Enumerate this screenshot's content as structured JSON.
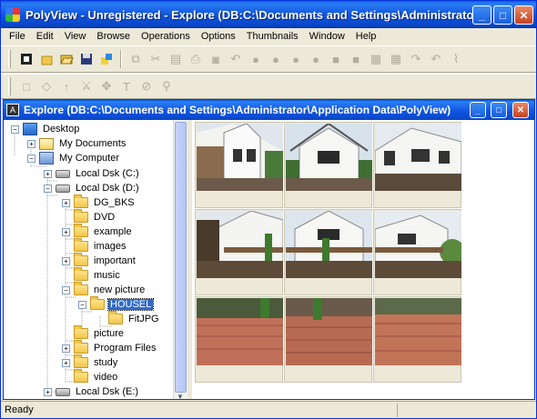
{
  "window": {
    "title": "PolyView - Unregistered - Explore (DB:C:\\Documents and Settings\\Administrator\\Application Data\\PolyView)",
    "minimize_label": "_",
    "maximize_label": "□",
    "close_label": "✕"
  },
  "menu": [
    "File",
    "Edit",
    "View",
    "Browse",
    "Operations",
    "Options",
    "Thumbnails",
    "Window",
    "Help"
  ],
  "child_window": {
    "title": "Explore (DB:C:\\Documents and Settings\\Administrator\\Application Data\\PolyView)",
    "icon_label": "A"
  },
  "tree": {
    "items": [
      {
        "label": "Desktop",
        "icon": "desktop-icon",
        "toggle": "−"
      },
      {
        "label": "My Documents",
        "icon": "my-documents-icon",
        "toggle": "+"
      },
      {
        "label": "My Computer",
        "icon": "my-computer-icon",
        "toggle": "−"
      },
      {
        "label": "Local Dsk (C:)",
        "icon": "drive-icon",
        "toggle": "+"
      },
      {
        "label": "Local Dsk (D:)",
        "icon": "drive-icon",
        "toggle": "−"
      },
      {
        "label": "DG_BKS",
        "icon": "folder-icon",
        "toggle": "+"
      },
      {
        "label": "DVD",
        "icon": "folder-icon",
        "toggle": ""
      },
      {
        "label": "example",
        "icon": "folder-icon",
        "toggle": "+"
      },
      {
        "label": "images",
        "icon": "folder-icon",
        "toggle": ""
      },
      {
        "label": "important",
        "icon": "folder-icon",
        "toggle": "+"
      },
      {
        "label": "music",
        "icon": "folder-icon",
        "toggle": ""
      },
      {
        "label": "new picture",
        "icon": "folder-icon",
        "toggle": "−"
      },
      {
        "label": "HOUSEL",
        "icon": "folder-open-icon",
        "toggle": "−",
        "selected": true
      },
      {
        "label": "FitJPG",
        "icon": "folder-icon",
        "toggle": ""
      },
      {
        "label": "picture",
        "icon": "folder-icon",
        "toggle": ""
      },
      {
        "label": "Program Files",
        "icon": "folder-icon",
        "toggle": "+"
      },
      {
        "label": "study",
        "icon": "folder-icon",
        "toggle": "+"
      },
      {
        "label": "video",
        "icon": "folder-icon",
        "toggle": ""
      },
      {
        "label": "Local Dsk (E:)",
        "icon": "drive-icon",
        "toggle": "+"
      }
    ]
  },
  "thumbnails": {
    "count": 9,
    "rows": 3,
    "columns": 3
  },
  "status": {
    "text": "Ready"
  },
  "colors": {
    "titlebar": "#1055e0",
    "selection": "#316ac5",
    "window_bg": "#ece9d8"
  }
}
